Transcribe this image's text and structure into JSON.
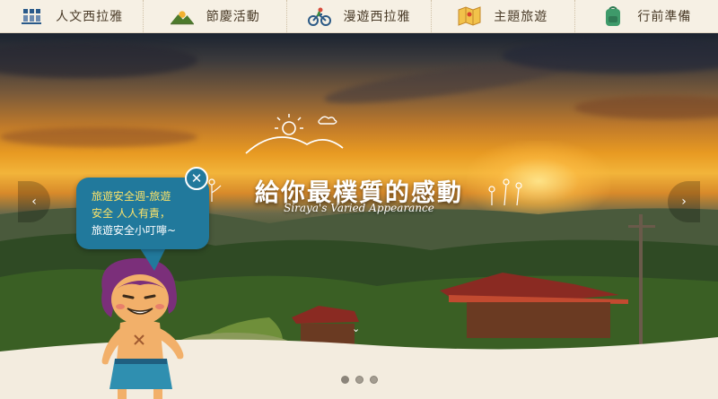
{
  "nav": {
    "items": [
      {
        "label": "人文西拉雅",
        "icon": "people-icon"
      },
      {
        "label": "節慶活動",
        "icon": "mountain-sun-icon"
      },
      {
        "label": "漫遊西拉雅",
        "icon": "cyclist-icon"
      },
      {
        "label": "主題旅遊",
        "icon": "map-icon"
      },
      {
        "label": "行前準備",
        "icon": "backpack-icon"
      }
    ]
  },
  "hero": {
    "title": "給你最樸質的感動",
    "subtitle": "Siraya's Varied Appearance",
    "prev_label": "‹",
    "next_label": "›",
    "scroll_label": "⌄"
  },
  "bubble": {
    "lines": [
      "旅遊安全週-旅遊",
      "安全 人人有責，",
      "旅遊安全小叮嚀~"
    ],
    "close_label": "✕"
  },
  "carousel": {
    "slides": 3,
    "active_index": 0
  },
  "colors": {
    "bubble": "#21799c",
    "bubble_highlight": "#fbe36a",
    "nav_bg": "#f6f0e4",
    "page_bg": "#f3ecdf"
  }
}
